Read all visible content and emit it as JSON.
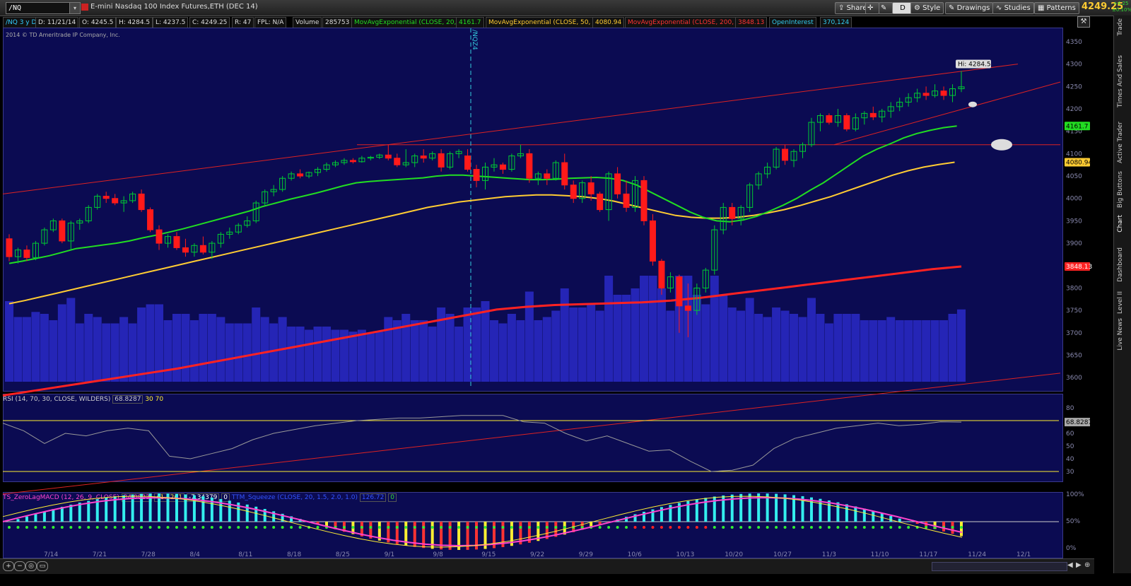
{
  "toolbar": {
    "symbol": "/NQ",
    "description": "E-mini Nasdaq 100 Index Futures,ETH (DEC 14)",
    "share": "Share",
    "timeframe": "D",
    "style": "Style",
    "drawings": "Drawings",
    "studies": "Studies",
    "patterns": "Patterns",
    "last_price": "4249.25",
    "change_top": "+4.25",
    "change_bot": "±0.10%"
  },
  "header": {
    "period": "/NQ 3 y D",
    "date": "D: 11/21/14",
    "open": "O: 4245.5",
    "high": "H: 4284.5",
    "low": "L: 4237.5",
    "close": "C: 4249.25",
    "range": "R: 47",
    "fpl": "FPL: N/A",
    "volume_label": "Volume",
    "volume": "285753",
    "ma20_label": "MovAvgExponential (CLOSE, 20, 0)",
    "ma20": "4161.7",
    "ma50_label": "MovAvgExponential (CLOSE, 50, 0)",
    "ma50": "4080.94",
    "ma200_label": "MovAvgExponential (CLOSE, 200, 0)",
    "ma200": "3848.13",
    "oi_label": "OpenInterest",
    "oi": "370,124",
    "copyright": "2014 © TD Ameritrade IP Company, Inc.",
    "marker": "/NQZ4",
    "hi_label": "Hi: 4284.5"
  },
  "rsi": {
    "label": "RSI (14, 70, 30, CLOSE, WILDERS)",
    "value": "68.8287",
    "os": "30",
    "ob": "70",
    "ticks": [
      "80",
      "70",
      "60",
      "50",
      "40",
      "30"
    ]
  },
  "macd": {
    "label": "TS_ZeroLagMACD (12, 26, 9, CLOSE)",
    "v1": "34.0823",
    "v2": "41.4261",
    "v3": "-7.34379",
    "v4": "0",
    "squeeze_label": "TTM_Squeeze (CLOSE, 20, 1.5, 2.0, 1.0)",
    "s1": "126.72",
    "s2": "0",
    "ticks": [
      "100%",
      "50%",
      "0%"
    ]
  },
  "sidebar": [
    "Trade",
    "Times And Sales",
    "Active Trader",
    "Big Buttons",
    "Chart",
    "Dashboard",
    "Level II",
    "Live News"
  ],
  "colors": {
    "up": "#00cc33",
    "down": "#ff1a1a",
    "ma20": "#22dd22",
    "ma50": "#ffcc33",
    "ma200": "#ff2222",
    "oi": "#33ccee",
    "vol": "#2a2ac8",
    "bg": "#0b0b52"
  },
  "chart_data": {
    "type": "candlestick",
    "x_dates": [
      "7/14",
      "7/21",
      "7/28",
      "8/4",
      "8/11",
      "8/18",
      "8/25",
      "9/1",
      "9/8",
      "9/15",
      "9/22",
      "9/29",
      "10/6",
      "10/13",
      "10/20",
      "10/27",
      "11/3",
      "11/10",
      "11/17",
      "11/24",
      "12/1"
    ],
    "ylim": [
      3575,
      4380
    ],
    "y_ticks": [
      3600,
      3650,
      3700,
      3750,
      3800,
      3850,
      3900,
      3950,
      4000,
      4050,
      4100,
      4150,
      4200,
      4250,
      4300,
      4350
    ],
    "candles": [
      [
        3910,
        3920,
        3860,
        3870
      ],
      [
        3870,
        3890,
        3855,
        3885
      ],
      [
        3885,
        3895,
        3860,
        3868
      ],
      [
        3868,
        3905,
        3862,
        3900
      ],
      [
        3900,
        3935,
        3895,
        3930
      ],
      [
        3930,
        3955,
        3925,
        3950
      ],
      [
        3950,
        3955,
        3900,
        3905
      ],
      [
        3905,
        3950,
        3885,
        3945
      ],
      [
        3945,
        3955,
        3930,
        3950
      ],
      [
        3950,
        3985,
        3945,
        3980
      ],
      [
        3980,
        4010,
        3975,
        4005
      ],
      [
        4005,
        4015,
        3990,
        4000
      ],
      [
        4000,
        4010,
        3985,
        3990
      ],
      [
        3990,
        4005,
        3970,
        3995
      ],
      [
        3995,
        4015,
        3990,
        4010
      ],
      [
        4010,
        4020,
        3970,
        3975
      ],
      [
        3975,
        3980,
        3925,
        3930
      ],
      [
        3930,
        3940,
        3885,
        3900
      ],
      [
        3900,
        3920,
        3890,
        3915
      ],
      [
        3915,
        3925,
        3885,
        3890
      ],
      [
        3890,
        3910,
        3870,
        3880
      ],
      [
        3880,
        3900,
        3870,
        3895
      ],
      [
        3895,
        3915,
        3875,
        3880
      ],
      [
        3880,
        3905,
        3865,
        3900
      ],
      [
        3900,
        3925,
        3890,
        3920
      ],
      [
        3920,
        3935,
        3910,
        3925
      ],
      [
        3925,
        3945,
        3920,
        3940
      ],
      [
        3940,
        3960,
        3935,
        3950
      ],
      [
        3950,
        3995,
        3945,
        3990
      ],
      [
        3990,
        4020,
        3985,
        4015
      ],
      [
        4015,
        4030,
        4005,
        4020
      ],
      [
        4020,
        4050,
        4015,
        4045
      ],
      [
        4045,
        4060,
        4040,
        4055
      ],
      [
        4055,
        4065,
        4045,
        4050
      ],
      [
        4050,
        4060,
        4045,
        4058
      ],
      [
        4058,
        4070,
        4050,
        4065
      ],
      [
        4065,
        4080,
        4060,
        4075
      ],
      [
        4075,
        4085,
        4070,
        4080
      ],
      [
        4080,
        4090,
        4075,
        4085
      ],
      [
        4085,
        4090,
        4078,
        4082
      ],
      [
        4082,
        4095,
        4080,
        4090
      ],
      [
        4090,
        4095,
        4085,
        4092
      ],
      [
        4092,
        4100,
        4088,
        4097
      ],
      [
        4097,
        4120,
        4085,
        4090
      ],
      [
        4090,
        4100,
        4070,
        4075
      ],
      [
        4075,
        4110,
        4070,
        4080
      ],
      [
        4080,
        4100,
        4070,
        4095
      ],
      [
        4095,
        4110,
        4080,
        4090
      ],
      [
        4090,
        4105,
        4085,
        4100
      ],
      [
        4100,
        4110,
        4060,
        4070
      ],
      [
        4070,
        4105,
        4065,
        4100
      ],
      [
        4100,
        4110,
        4090,
        4105
      ],
      [
        4095,
        4110,
        4060,
        4065
      ],
      [
        4065,
        4075,
        4025,
        4040
      ],
      [
        4040,
        4080,
        4020,
        4070
      ],
      [
        4070,
        4090,
        4060,
        4075
      ],
      [
        4075,
        4080,
        4055,
        4065
      ],
      [
        4065,
        4100,
        4060,
        4095
      ],
      [
        4095,
        4120,
        4090,
        4100
      ],
      [
        4100,
        4110,
        4035,
        4045
      ],
      [
        4045,
        4060,
        4030,
        4055
      ],
      [
        4055,
        4065,
        4030,
        4045
      ],
      [
        4045,
        4085,
        4040,
        4080
      ],
      [
        4080,
        4100,
        4020,
        4030
      ],
      [
        4030,
        4040,
        3990,
        4000
      ],
      [
        4000,
        4040,
        3990,
        4035
      ],
      [
        4035,
        4050,
        3995,
        4010
      ],
      [
        4010,
        4015,
        3970,
        3975
      ],
      [
        3975,
        4060,
        3950,
        4055
      ],
      [
        4055,
        4070,
        4000,
        4010
      ],
      [
        4010,
        4040,
        3970,
        3980
      ],
      [
        3980,
        4050,
        3970,
        4040
      ],
      [
        4040,
        4050,
        3940,
        3950
      ],
      [
        3950,
        3965,
        3850,
        3860
      ],
      [
        3860,
        3865,
        3785,
        3800
      ],
      [
        3800,
        3835,
        3790,
        3825
      ],
      [
        3825,
        3830,
        3700,
        3760
      ],
      [
        3760,
        3810,
        3690,
        3750
      ],
      [
        3750,
        3810,
        3740,
        3800
      ],
      [
        3800,
        3845,
        3790,
        3840
      ],
      [
        3840,
        3940,
        3830,
        3930
      ],
      [
        3930,
        3990,
        3920,
        3980
      ],
      [
        3980,
        3990,
        3940,
        3955
      ],
      [
        3955,
        3985,
        3940,
        3980
      ],
      [
        3980,
        4035,
        3970,
        4030
      ],
      [
        4030,
        4060,
        4020,
        4055
      ],
      [
        4055,
        4080,
        4045,
        4070
      ],
      [
        4070,
        4115,
        4065,
        4110
      ],
      [
        4110,
        4120,
        4075,
        4085
      ],
      [
        4085,
        4110,
        4070,
        4105
      ],
      [
        4105,
        4125,
        4090,
        4120
      ],
      [
        4120,
        4180,
        4115,
        4170
      ],
      [
        4170,
        4190,
        4150,
        4185
      ],
      [
        4185,
        4190,
        4165,
        4170
      ],
      [
        4170,
        4200,
        4160,
        4185
      ],
      [
        4185,
        4190,
        4150,
        4155
      ],
      [
        4155,
        4190,
        4150,
        4180
      ],
      [
        4180,
        4195,
        4165,
        4190
      ],
      [
        4190,
        4205,
        4175,
        4182
      ],
      [
        4182,
        4200,
        4170,
        4195
      ],
      [
        4195,
        4215,
        4180,
        4205
      ],
      [
        4205,
        4225,
        4195,
        4215
      ],
      [
        4215,
        4235,
        4205,
        4225
      ],
      [
        4225,
        4245,
        4215,
        4235
      ],
      [
        4235,
        4250,
        4220,
        4230
      ],
      [
        4230,
        4255,
        4225,
        4240
      ],
      [
        4240,
        4250,
        4220,
        4230
      ],
      [
        4230,
        4255,
        4215,
        4245
      ],
      [
        4245,
        4284.5,
        4237.5,
        4249.25
      ]
    ],
    "ma20": [
      3855,
      3860,
      3866,
      3872,
      3880,
      3888,
      3892,
      3896,
      3900,
      3905,
      3912,
      3918,
      3925,
      3932,
      3940,
      3948,
      3956,
      3964,
      3972,
      3982,
      3990,
      3998,
      4005,
      4012,
      4020,
      4028,
      4035,
      4038,
      4040,
      4042,
      4044,
      4046,
      4050,
      4052,
      4052,
      4050,
      4048,
      4046,
      4044,
      4042,
      4042,
      4043,
      4045,
      4046,
      4047,
      4045,
      4040,
      4030,
      4015,
      4000,
      3985,
      3970,
      3958,
      3950,
      3948,
      3952,
      3960,
      3972,
      3985,
      4000,
      4018,
      4035,
      4055,
      4075,
      4095,
      4110,
      4122,
      4135,
      4145,
      4152,
      4158,
      4161.7
    ],
    "ma50": [
      3765,
      3772,
      3780,
      3788,
      3796,
      3804,
      3812,
      3820,
      3828,
      3836,
      3844,
      3852,
      3860,
      3868,
      3876,
      3884,
      3892,
      3900,
      3908,
      3916,
      3924,
      3932,
      3940,
      3948,
      3956,
      3964,
      3972,
      3980,
      3986,
      3992,
      3996,
      4000,
      4004,
      4006,
      4008,
      4008,
      4006,
      4004,
      4000,
      3994,
      3986,
      3978,
      3970,
      3962,
      3958,
      3956,
      3956,
      3958,
      3962,
      3968,
      3975,
      3984,
      3994,
      4004,
      4016,
      4028,
      4040,
      4052,
      4062,
      4070,
      4076,
      4080.94
    ],
    "ma200": [
      3560,
      3570,
      3580,
      3590,
      3600,
      3610,
      3620,
      3632,
      3644,
      3656,
      3668,
      3680,
      3692,
      3704,
      3716,
      3728,
      3740,
      3752,
      3758,
      3762,
      3764,
      3766,
      3768,
      3772,
      3778,
      3786,
      3794,
      3802,
      3810,
      3818,
      3826,
      3834,
      3842,
      3848.13
    ],
    "rsi": [
      68,
      62,
      52,
      60,
      58,
      62,
      64,
      62,
      42,
      40,
      44,
      48,
      55,
      60,
      63,
      66,
      68,
      70,
      71,
      72,
      72,
      73,
      74,
      74,
      74,
      69,
      68,
      60,
      54,
      58,
      52,
      46,
      47,
      38,
      30,
      31,
      35,
      48,
      56,
      60,
      64,
      66,
      68,
      66,
      67,
      69,
      68.8287
    ]
  }
}
